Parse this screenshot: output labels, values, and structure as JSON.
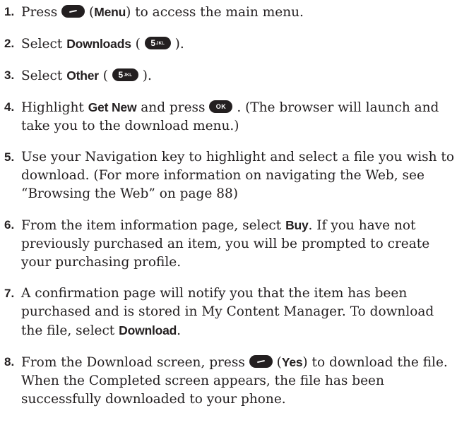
{
  "steps": [
    {
      "number": "1.",
      "text_before": "Press",
      "key_icon": "menu-softkey-icon",
      "label_bold": "Menu",
      "text_after": "to access the main menu."
    },
    {
      "number": "2.",
      "text_before": "Select",
      "label_bold": "Downloads",
      "key_icon": "key-5-jkl-icon",
      "key_main": "5",
      "key_sub": "JKL"
    },
    {
      "number": "3.",
      "text_before": "Select",
      "label_bold": "Other",
      "key_icon": "key-5-jkl-icon",
      "key_main": "5",
      "key_sub": "JKL"
    },
    {
      "number": "4.",
      "text_before": "Highlight",
      "label_bold": "Get New",
      "text_middle": "and press",
      "key_icon": "ok-key-icon",
      "key_text": "OK",
      "text_after": ". (The browser will launch and take you to the download menu.)"
    },
    {
      "number": "5.",
      "text": "Use your Navigation key to highlight and select a file you wish to download. (For more information on navigating the Web, see “Browsing the Web” on page 88)"
    },
    {
      "number": "6.",
      "text_before": "From the item information page, select",
      "label_bold": "Buy",
      "text_after": ". If you have not previously purchased an item, you will be prompted to create your purchasing profile."
    },
    {
      "number": "7.",
      "text_before": "A confirmation page will notify you that the item has been purchased and is stored in My Content Manager. To download the file, select",
      "label_bold": "Download",
      "text_after": "."
    },
    {
      "number": "8.",
      "text_before": "From the Download screen, press",
      "key_icon": "yes-softkey-icon",
      "label_bold": "Yes",
      "text_after": "to download the file. When the Completed screen appears, the file has been successfully downloaded to your phone."
    }
  ],
  "colors": {
    "text": "#231f20",
    "key_fill": "#231f20",
    "key_text": "#ffffff"
  }
}
